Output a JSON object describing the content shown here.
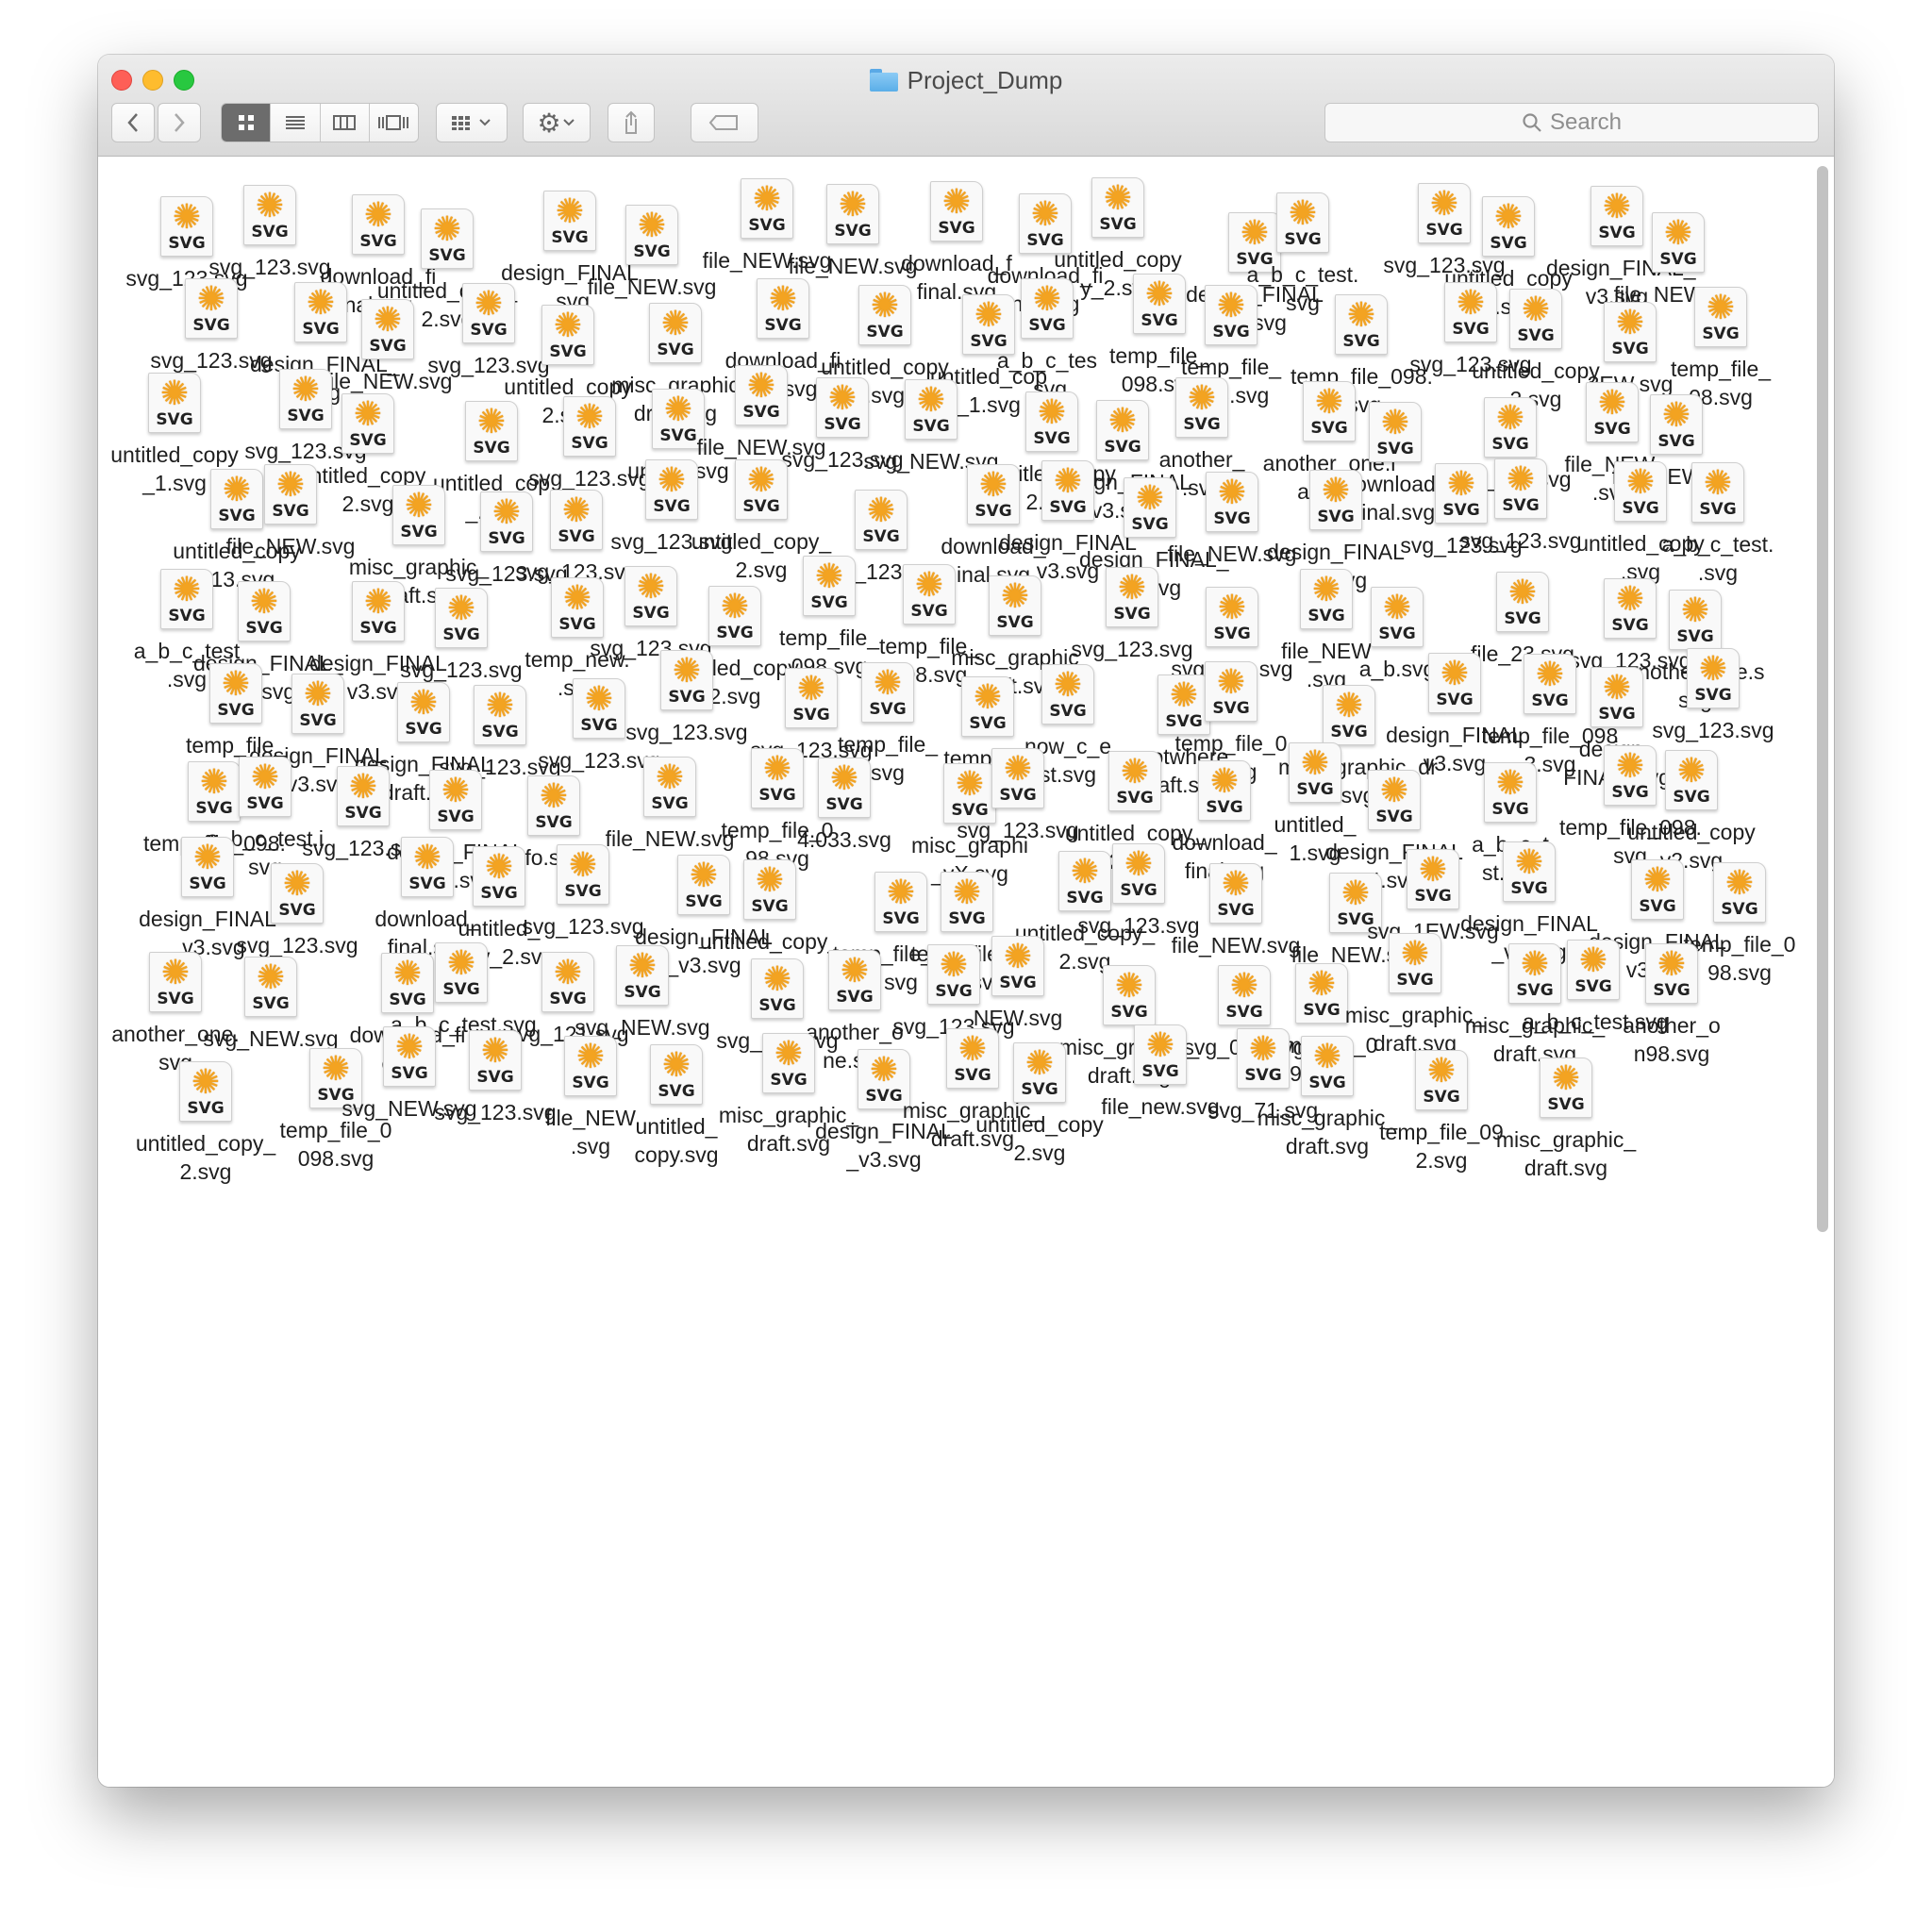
{
  "window": {
    "title": "Project_Dump"
  },
  "toolbar": {
    "back_icon": "chevron-left-icon",
    "forward_icon": "chevron-right-icon",
    "views": [
      "icon-view-icon",
      "list-view-icon",
      "column-view-icon",
      "gallery-view-icon"
    ],
    "group_icon": "group-by-icon",
    "action_icon": "gear-icon",
    "share_icon": "share-icon",
    "tags_icon": "tag-icon"
  },
  "search": {
    "placeholder": "Search"
  },
  "colors": {
    "svg_badge": "#f3a321",
    "active_view": "#6c6c6c"
  },
  "file_icon": {
    "badge_label": "SVG"
  },
  "files": [
    {
      "name": "svg_123.svg"
    },
    {
      "name": "svg_123.svg"
    },
    {
      "name": "download_fi\nnal.svg"
    },
    {
      "name": "untitled_copy_\n2.svg"
    },
    {
      "name": "design_FINAL\n.svg"
    },
    {
      "name": "file_NEW.svg"
    },
    {
      "name": "file_NEW.svg"
    },
    {
      "name": "file_NEW.svg"
    },
    {
      "name": "download_f\nfinal.svg"
    },
    {
      "name": "download_fi\nnal.svg"
    },
    {
      "name": "untitled_copy\ny_2.svg"
    },
    {
      "name": "design_FINAL\n_1.svg"
    },
    {
      "name": "a_b_c_test.\nsvg"
    },
    {
      "name": "svg_123.svg"
    },
    {
      "name": "untitled_copy\n2.svg"
    },
    {
      "name": "design_FINAL_\nv3.svg"
    },
    {
      "name": "file_NEW.svg"
    },
    {
      "name": "svg_123.svg"
    },
    {
      "name": "design_FINAL_\n.svg"
    },
    {
      "name": "file_NEW.svg"
    },
    {
      "name": "svg_123.svg"
    },
    {
      "name": "untitled_copy\n2.svg"
    },
    {
      "name": "misc_graphic\ndraft.svg"
    },
    {
      "name": "download_fi\nnal.svg"
    },
    {
      "name": "untitled_copy\n.svg"
    },
    {
      "name": "untitled_cop\n_1.svg"
    },
    {
      "name": "a_b_c_tes\n.svg"
    },
    {
      "name": "temp_file_\n098.svg"
    },
    {
      "name": "temp_file_\n098.svg"
    },
    {
      "name": "temp_file_098.\n.svg"
    },
    {
      "name": "svg_123.svg"
    },
    {
      "name": "untitled_copy\n2.svg"
    },
    {
      "name": "3EW.svg"
    },
    {
      "name": "temp_file_\n08.svg"
    },
    {
      "name": "untitled_copy\n_1.svg"
    },
    {
      "name": "svg_123.svg"
    },
    {
      "name": "untitled_copy_\n2.svg"
    },
    {
      "name": "untitled_cop\n_.svg"
    },
    {
      "name": "svg_123.svg"
    },
    {
      "name": "untw.z.svg"
    },
    {
      "name": "file_NEW.svg"
    },
    {
      "name": "svg_123.svg"
    },
    {
      "name": "svg_NEW.svg"
    },
    {
      "name": "untitled_copy\n2.svg"
    },
    {
      "name": "design_FINAL\nv3.svg"
    },
    {
      "name": "another_\n.svg"
    },
    {
      "name": "another_one.l\naft.svg"
    },
    {
      "name": "download_\nfinal.svg"
    },
    {
      "name": "svg_123.svg"
    },
    {
      "name": "file_NEW.\n.svg"
    },
    {
      "name": "file_NEW.svg"
    },
    {
      "name": "untitled_copy\n_13.svg"
    },
    {
      "name": "file_NEW.svg"
    },
    {
      "name": "misc_graphic_\ndraft.svg"
    },
    {
      "name": "svg_123.svg"
    },
    {
      "name": "svg_123.svg"
    },
    {
      "name": "svg_123.svg"
    },
    {
      "name": "untitled_copy_\n2.svg"
    },
    {
      "name": "svg_123.svg"
    },
    {
      "name": "download_\ninal.svg"
    },
    {
      "name": "design_FINAL\nv3.svg"
    },
    {
      "name": "design_FINAL_\nv3.svg"
    },
    {
      "name": "file_NEW.svg"
    },
    {
      "name": "design_FINAL\nv3.svg"
    },
    {
      "name": "svg_123.svg"
    },
    {
      "name": "svg_123.svg"
    },
    {
      "name": "untitled_copy\n.svg"
    },
    {
      "name": "a_b_c_test.\n.svg"
    },
    {
      "name": "a_b_c_test\n.svg"
    },
    {
      "name": "design_FINAL_\nv3.svg"
    },
    {
      "name": "design_FINAL\nv3.svg"
    },
    {
      "name": "svg_123.svg"
    },
    {
      "name": "temp_new.\n.svg"
    },
    {
      "name": "svg_123.svg"
    },
    {
      "name": "untitled_copy\n2.svg"
    },
    {
      "name": "temp_file_\n098.svg"
    },
    {
      "name": "temp_file_\n098.svg"
    },
    {
      "name": "misc_graphic\ndraft.svg"
    },
    {
      "name": "svg_123.svg"
    },
    {
      "name": "svg_123.svg"
    },
    {
      "name": "file_NEW\n.svg"
    },
    {
      "name": "a_b.svg"
    },
    {
      "name": "file_23.svg"
    },
    {
      "name": "svg_123.svg"
    },
    {
      "name": "another_one.s\nsvg"
    },
    {
      "name": "temp_file_\n12.svg"
    },
    {
      "name": "design_FINAL\nv3.svg"
    },
    {
      "name": "design_FINAL\ndraft.svg"
    },
    {
      "name": "svg_123.svg"
    },
    {
      "name": "svg_123.svg"
    },
    {
      "name": "svg_123.svg"
    },
    {
      "name": "svg_123.svg"
    },
    {
      "name": "temp_file_\nsvg"
    },
    {
      "name": "temp_file\n98.svg"
    },
    {
      "name": "now_c_e\nst.svg"
    },
    {
      "name": "anotwhere_\nnaft.svg"
    },
    {
      "name": "temp_file_0\n3.svg"
    },
    {
      "name": "misc_graphic_dr\nft.svg"
    },
    {
      "name": "design_FINAL\nv3.svg"
    },
    {
      "name": "temp_file_098\n3.svg"
    },
    {
      "name": "design_\nFINAL_svg"
    },
    {
      "name": "svg_123.svg"
    },
    {
      "name": "temp_file_098.\nsvg"
    },
    {
      "name": "a_b_c_test.i\nsvg"
    },
    {
      "name": "svg_123.svg"
    },
    {
      "name": "design_FINAL\n_v3.svg"
    },
    {
      "name": "fo.svg"
    },
    {
      "name": "file_NEW.svg"
    },
    {
      "name": "temp_file_0\n98.svg"
    },
    {
      "name": "4:033.svg"
    },
    {
      "name": "misc_graphi\n_vX.svg"
    },
    {
      "name": "svg_123.svg"
    },
    {
      "name": "untitled_copy_\n2.svg"
    },
    {
      "name": "download_\nfinal.svg"
    },
    {
      "name": "untitled_\n1.svg"
    },
    {
      "name": "design_FINAL\n4.svg"
    },
    {
      "name": "a_b_c_t\nst.svg"
    },
    {
      "name": "temp_file_098.\nsvg"
    },
    {
      "name": "untitled_copy\nv2.svg"
    },
    {
      "name": "design_FINAL\n_v3.svg"
    },
    {
      "name": "svg_123.svg"
    },
    {
      "name": "download_\nfinal.svg"
    },
    {
      "name": "untitled_\ncopy_2.svg"
    },
    {
      "name": "svg_123.svg"
    },
    {
      "name": "design_FINAL\n_v3.svg"
    },
    {
      "name": "untitled_copy_\n.svg"
    },
    {
      "name": "temp_file_098\nsvg"
    },
    {
      "name": "temp_file_0\n098.svg"
    },
    {
      "name": "untitled_copy_\n2.svg"
    },
    {
      "name": "svg_123.svg"
    },
    {
      "name": "file_NEW.svg"
    },
    {
      "name": "file_NEW.svg"
    },
    {
      "name": "svg_1EW.svg"
    },
    {
      "name": "design_FINAL\n_v3.svg"
    },
    {
      "name": "design_FINAL\nv3.svg"
    },
    {
      "name": "temp_file_0\n98.svg"
    },
    {
      "name": "another_one.\nsvg"
    },
    {
      "name": "svg_NEW.svg"
    },
    {
      "name": "download_fi\ne.svg"
    },
    {
      "name": "a_b_c_test.svg"
    },
    {
      "name": "svg_121.svg"
    },
    {
      "name": "svg_NEW.svg"
    },
    {
      "name": "svg_123.svg"
    },
    {
      "name": "another_o\nne.svg"
    },
    {
      "name": "svg_123.svg"
    },
    {
      "name": "NEW.svg"
    },
    {
      "name": "misc_graphic_\ndraft.svg"
    },
    {
      "name": "svg_095.svg"
    },
    {
      "name": "temp_file_0\n98.svg"
    },
    {
      "name": "misc_graphic_\ndraft.svg"
    },
    {
      "name": "misc_graphic_\ndraft.svg"
    },
    {
      "name": "a_b_c_test.svg"
    },
    {
      "name": "another_o\nn98.svg"
    },
    {
      "name": "untitled_copy_\n2.svg"
    },
    {
      "name": "temp_file_0\n098.svg"
    },
    {
      "name": "svg_NEW.svg"
    },
    {
      "name": "svg_123.svg"
    },
    {
      "name": "file_NEW\n.svg"
    },
    {
      "name": "untitled_\ncopy.svg"
    },
    {
      "name": "misc_graphic_\ndraft.svg"
    },
    {
      "name": "design_FINAL\n_v3.svg"
    },
    {
      "name": "misc_graphic_\ndraft.svg"
    },
    {
      "name": "untitled_copy\n2.svg"
    },
    {
      "name": "file_new.svg"
    },
    {
      "name": "svg_71.svg"
    },
    {
      "name": "misc_graphic_\ndraft.svg"
    },
    {
      "name": "temp_file_09\n2.svg"
    },
    {
      "name": "misc_graphic_\ndraft.svg"
    }
  ]
}
